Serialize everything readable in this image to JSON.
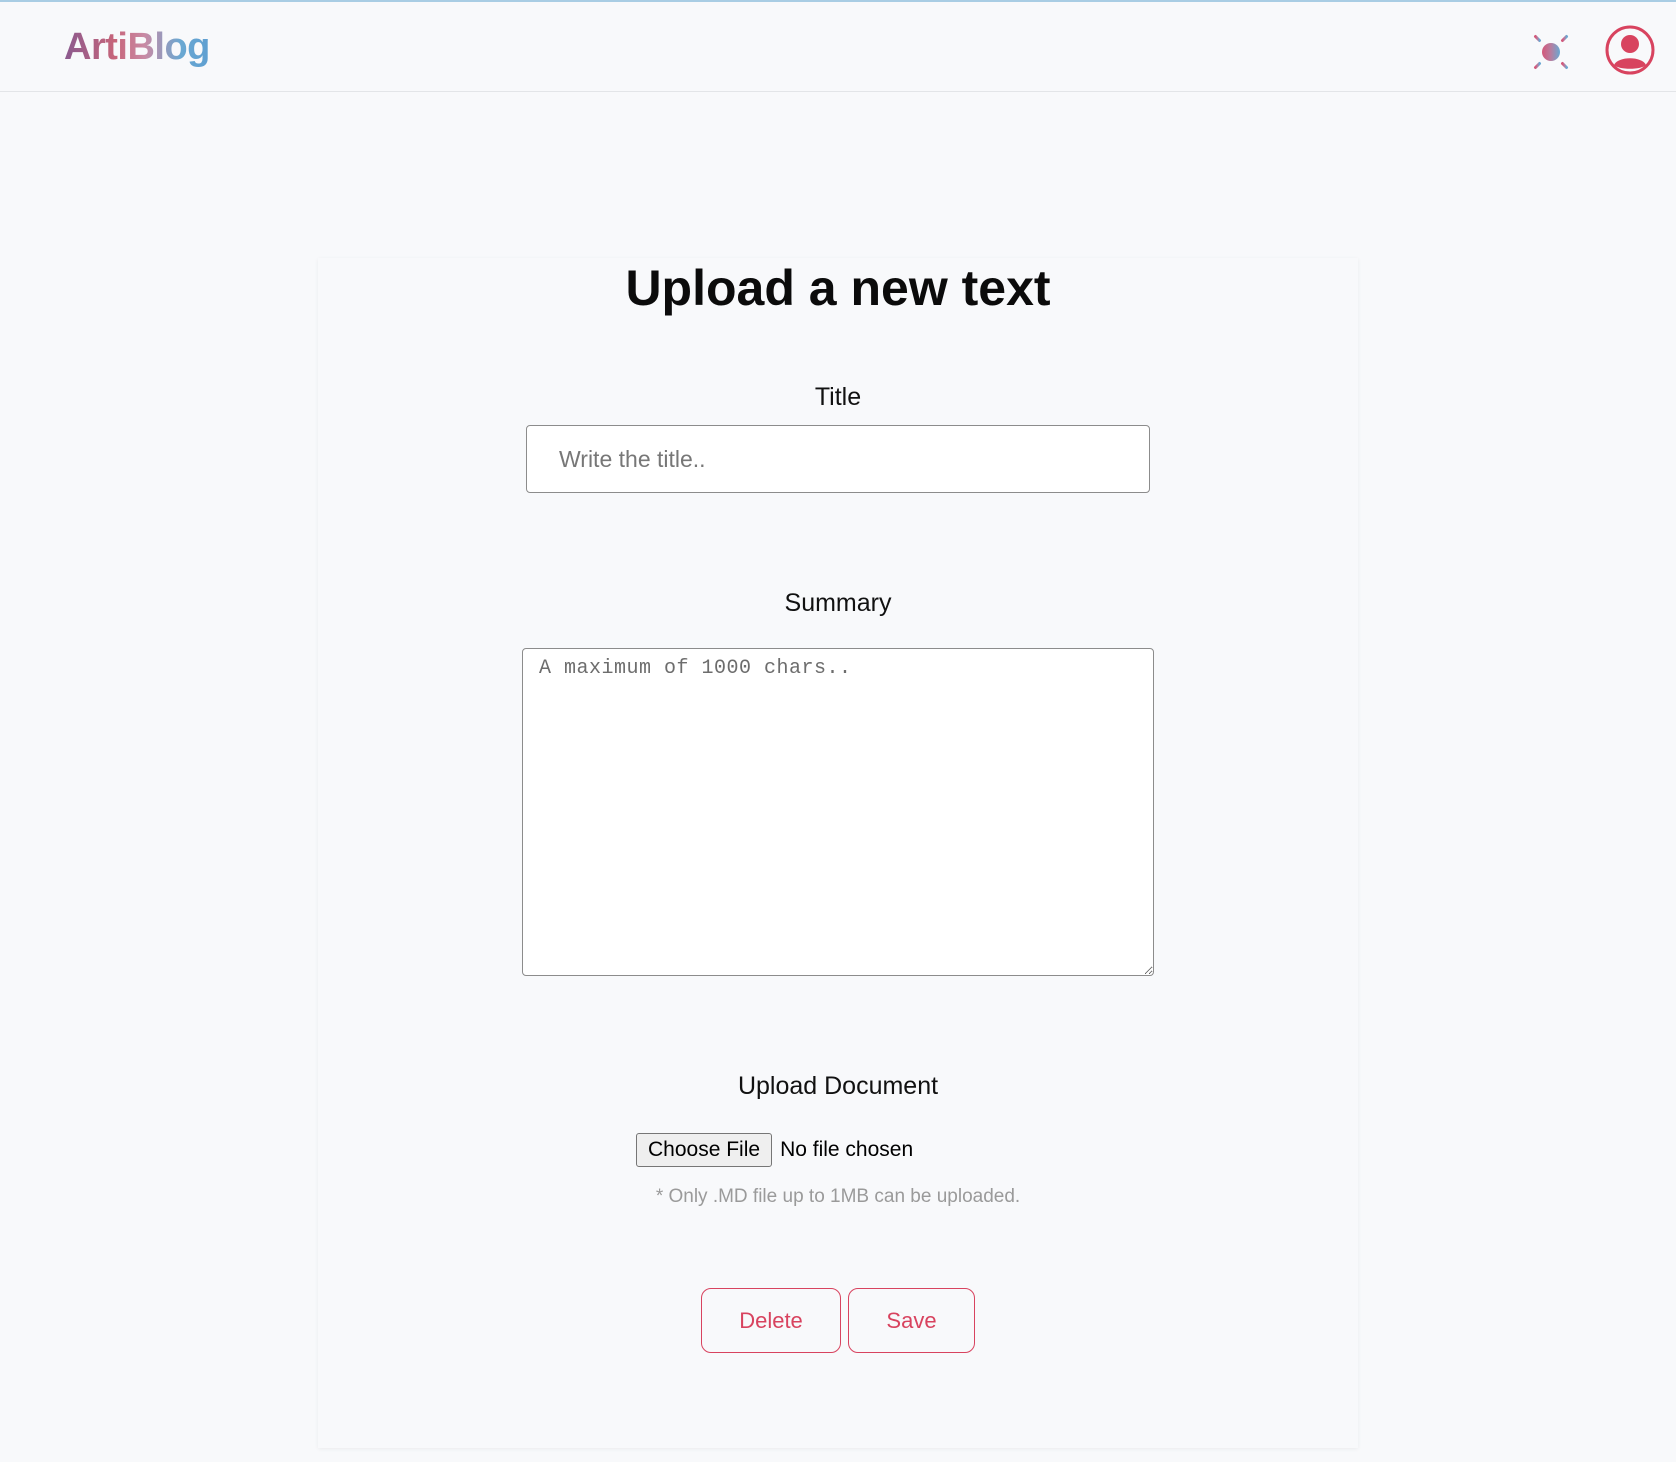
{
  "header": {
    "logo_text": "ArtiBlog",
    "theme_icon": "sun-icon",
    "avatar_icon": "user-avatar-icon"
  },
  "page": {
    "title": "Upload a new text"
  },
  "form": {
    "title_label": "Title",
    "title_placeholder": "Write the title..",
    "summary_label": "Summary",
    "summary_placeholder": "A maximum of 1000 chars..",
    "upload_label": "Upload Document",
    "choose_file_label": "Choose File",
    "no_file_text": "No file chosen",
    "upload_hint": "* Only .MD file up to 1MB can be uploaded."
  },
  "actions": {
    "delete_label": "Delete",
    "save_label": "Save"
  },
  "colors": {
    "accent": "#d8435f",
    "logo_gradient_start": "#8a5a8f",
    "logo_gradient_end": "#5e9fd1",
    "background": "#f8f9fb"
  }
}
